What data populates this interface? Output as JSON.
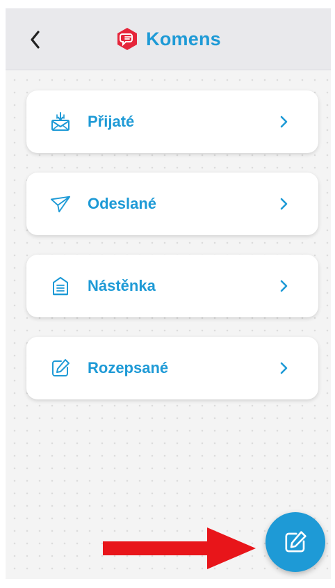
{
  "header": {
    "title": "Komens",
    "back_icon": "chevron-left-icon",
    "logo_icon": "chat-bubble-logo-icon",
    "accent_color": "#1e9ad6",
    "logo_color": "#e5253a"
  },
  "menu": {
    "items": [
      {
        "label": "Přijaté",
        "icon": "inbox-mail-icon"
      },
      {
        "label": "Odeslané",
        "icon": "paper-plane-icon"
      },
      {
        "label": "Nástěnka",
        "icon": "noticeboard-icon"
      },
      {
        "label": "Rozepsané",
        "icon": "edit-draft-icon"
      }
    ]
  },
  "fab": {
    "icon": "compose-icon"
  },
  "annotation": {
    "arrow_color": "#e8151a"
  }
}
